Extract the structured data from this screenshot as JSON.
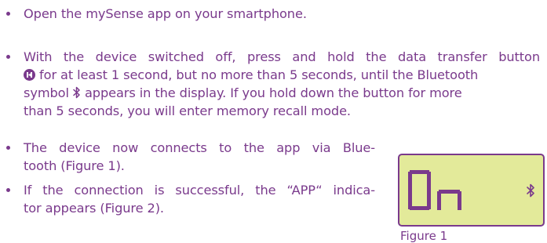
{
  "bullets": [
    {
      "lines": [
        "Open the mySense app on your smartphone."
      ]
    },
    {
      "l1": "With the device switched off, press and hold the data transfer button",
      "l2a": "for at least 1 second, but no more than 5 seconds, until the Bluetooth",
      "l3a": "symbol",
      "l3b": "appears in the display. If you hold down the button for more",
      "l4": "than 5 seconds, you will enter memory recall mode."
    },
    {
      "l1": "The device now connects to the app via Blue-",
      "l2": "tooth (Figure 1)."
    },
    {
      "l1": "If the connection is successful, the “APP“ indica-",
      "l2": "tor appears (Figure 2)."
    }
  ],
  "display": {
    "text": "On",
    "icon": "bluetooth-icon"
  },
  "figure_caption": "Figure 1",
  "icons": {
    "data_transfer_button": "data-transfer-button-icon",
    "bluetooth_inline": "bluetooth-icon"
  },
  "colors": {
    "text": "#7a3a8c",
    "display_background": "#e3ea9a"
  }
}
